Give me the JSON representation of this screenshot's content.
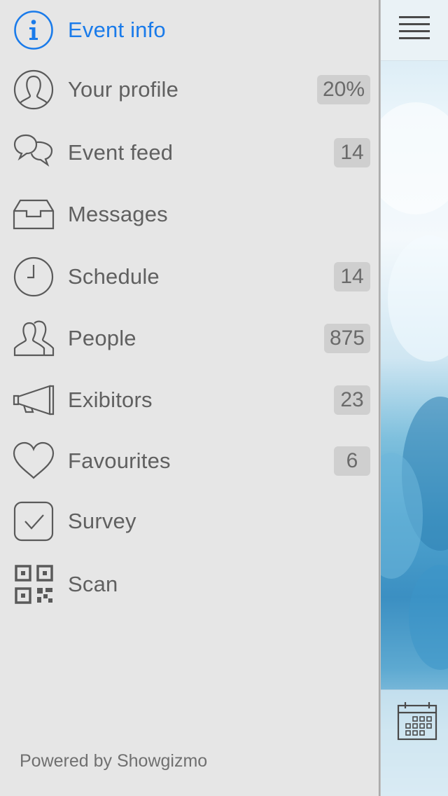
{
  "menu": {
    "items": [
      {
        "label": "Event info",
        "badge": null,
        "icon": "info-icon",
        "active": true
      },
      {
        "label": "Your profile",
        "badge": "20%",
        "icon": "profile-icon"
      },
      {
        "label": "Event feed",
        "badge": "14",
        "icon": "chat-bubbles-icon"
      },
      {
        "label": "Messages",
        "badge": null,
        "icon": "inbox-tray-icon"
      },
      {
        "label": "Schedule",
        "badge": "14",
        "icon": "clock-icon"
      },
      {
        "label": "People",
        "badge": "875",
        "icon": "people-icon"
      },
      {
        "label": "Exibitors",
        "badge": "23",
        "icon": "megaphone-icon"
      },
      {
        "label": "Favourites",
        "badge": "6",
        "icon": "heart-icon"
      },
      {
        "label": "Survey",
        "badge": null,
        "icon": "checkbox-icon"
      },
      {
        "label": "Scan",
        "badge": null,
        "icon": "qr-code-icon"
      }
    ],
    "footer": "Powered by Showgizmo"
  },
  "colors": {
    "active": "#1a7bea",
    "text": "#606060",
    "icon": "#5a5a5a",
    "badge_bg": "#cfcfcf",
    "background": "#e6e6e6"
  },
  "topbar": {
    "menu_icon": "hamburger-menu-icon"
  },
  "bottombar": {
    "calendar_icon": "calendar-icon"
  }
}
